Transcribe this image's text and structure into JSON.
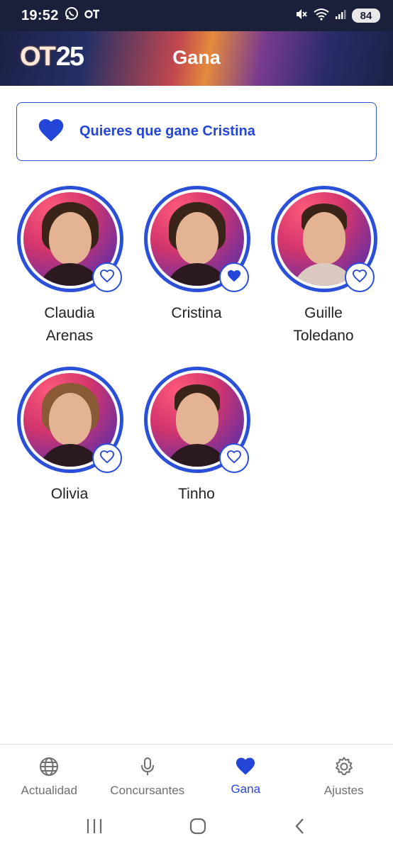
{
  "status_bar": {
    "time": "19:52",
    "battery": "84",
    "icons": [
      "whatsapp-icon",
      "ot-app-icon",
      "mute-icon",
      "wifi-icon",
      "signal-icon"
    ]
  },
  "header": {
    "logo_text_ot": "OT",
    "logo_text_num": "25",
    "title": "Gana",
    "colors": {
      "dark": "#1c2146",
      "orange": "#e58a3c",
      "magenta": "#c2474f"
    }
  },
  "vote_banner": {
    "text": "Quieres que gane Cristina",
    "icon": "heart-filled-icon",
    "accent": "#2446d8"
  },
  "contestants": [
    {
      "name_line1": "Claudia",
      "name_line2": "Arenas",
      "favorite": false
    },
    {
      "name_line1": "Cristina",
      "name_line2": "",
      "favorite": true
    },
    {
      "name_line1": "Guille",
      "name_line2": "Toledano",
      "favorite": false
    },
    {
      "name_line1": "Olivia",
      "name_line2": "",
      "favorite": false
    },
    {
      "name_line1": "Tinho",
      "name_line2": "",
      "favorite": false
    }
  ],
  "bottom_nav": {
    "items": [
      {
        "label": "Actualidad",
        "icon": "globe-icon",
        "active": false
      },
      {
        "label": "Concursantes",
        "icon": "microphone-icon",
        "active": false
      },
      {
        "label": "Gana",
        "icon": "heart-icon",
        "active": true
      },
      {
        "label": "Ajustes",
        "icon": "gear-icon",
        "active": false
      }
    ]
  },
  "system_nav": {
    "items": [
      "recents-icon",
      "home-icon",
      "back-icon"
    ]
  }
}
